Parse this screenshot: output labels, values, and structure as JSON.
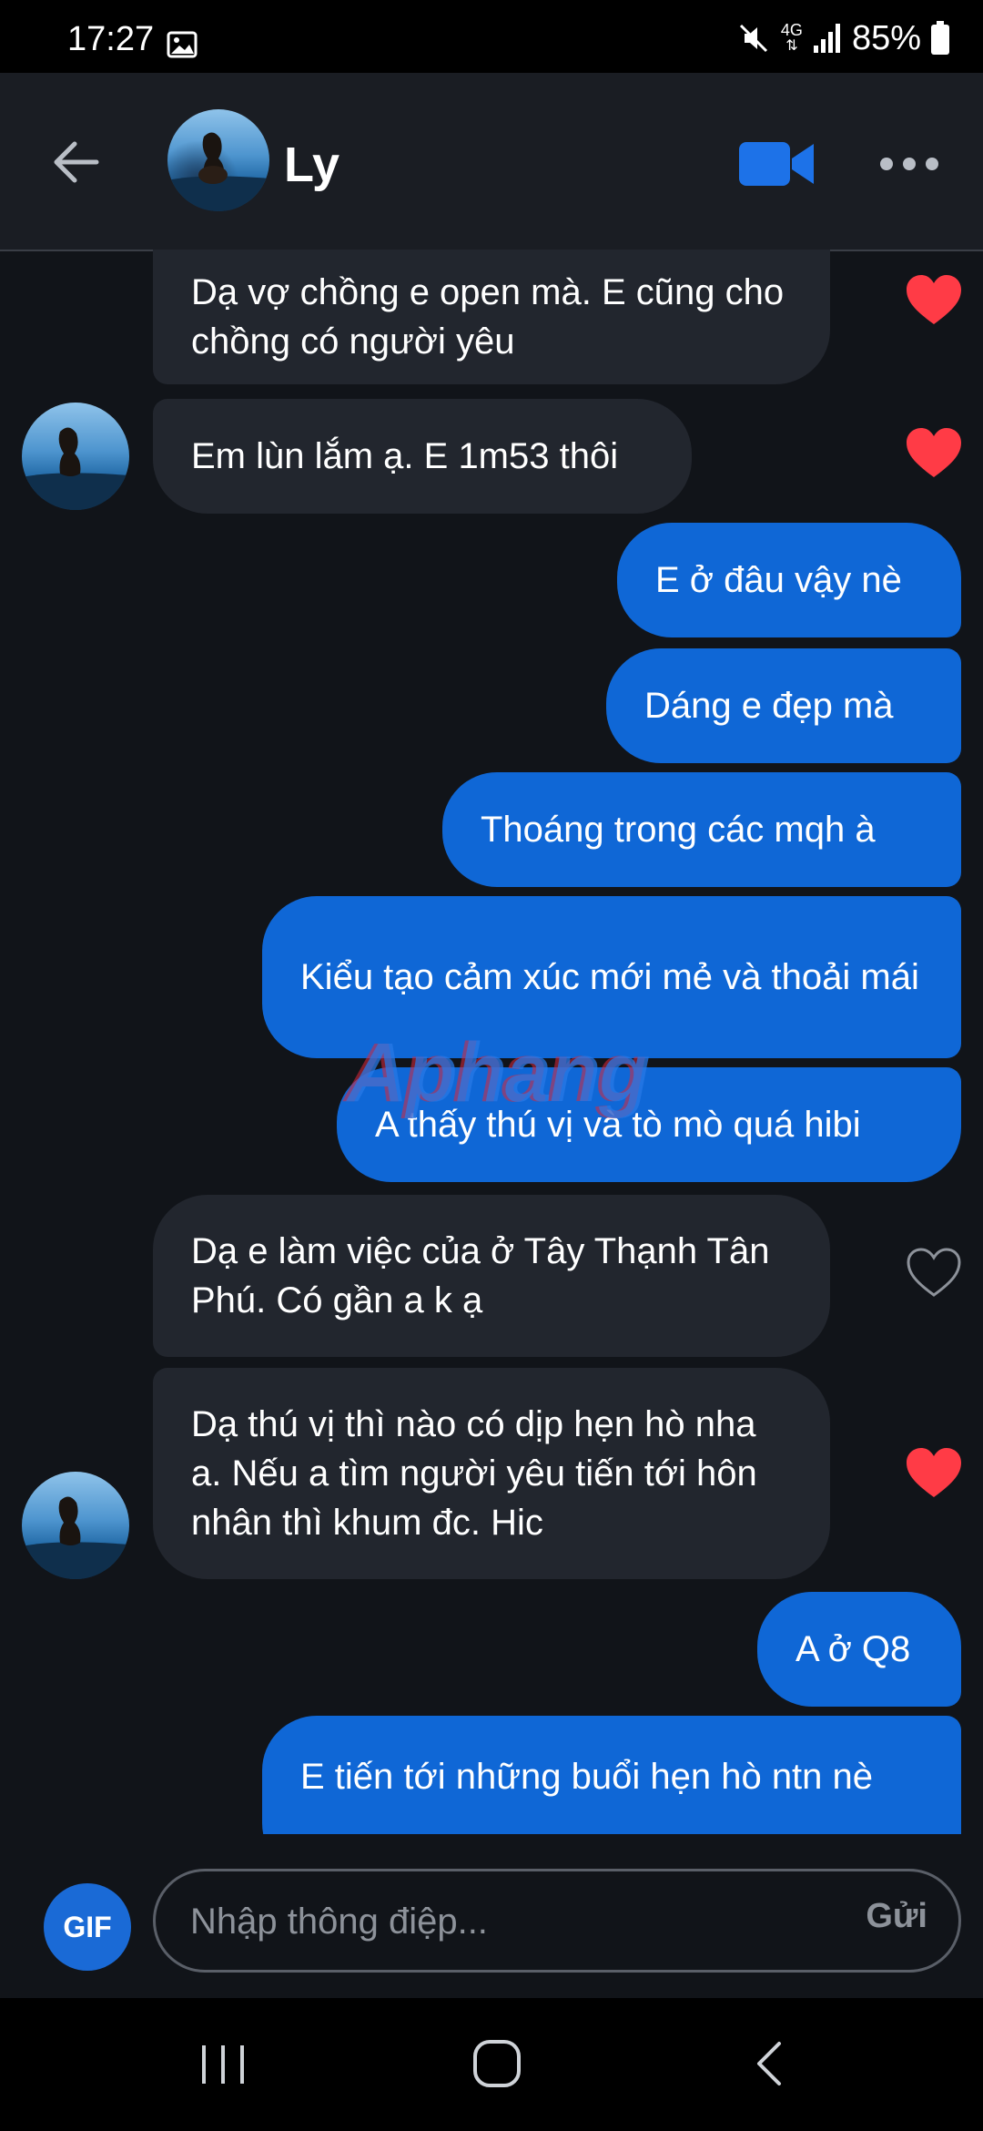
{
  "status_bar": {
    "time": "17:27",
    "network": "4G",
    "battery": "85%"
  },
  "header": {
    "contact_name": "Ly"
  },
  "messages": [
    {
      "side": "in",
      "text": "Dạ vợ chồng e open mà. E cũng cho chồng có người yêu",
      "liked": true
    },
    {
      "side": "in",
      "text": "Em lùn lắm ạ. E 1m53 thôi",
      "liked": true
    },
    {
      "side": "out",
      "text": "E ở đâu vậy nè"
    },
    {
      "side": "out",
      "text": "Dáng e đẹp mà"
    },
    {
      "side": "out",
      "text": "Thoáng trong các mqh à"
    },
    {
      "side": "out",
      "text": "Kiểu tạo cảm xúc mới mẻ và thoải mái"
    },
    {
      "side": "out",
      "text": "A thấy thú vị và tò mò quá hibi"
    },
    {
      "side": "in",
      "text": "Dạ e làm việc của ở Tây Thạnh Tân Phú. Có gần a k ạ",
      "liked": false
    },
    {
      "side": "in",
      "text": "Dạ thú vị thì nào có dịp hẹn hò nha a. Nếu a tìm người yêu tiến tới hôn nhân thì khum đc. Hic",
      "liked": true
    },
    {
      "side": "out",
      "text": "A ở Q8"
    },
    {
      "side": "out",
      "text": "E tiến tới những buổi hẹn hò ntn nè"
    }
  ],
  "watermark": "Aphang",
  "composer": {
    "gif_label": "GIF",
    "placeholder": "Nhập thông điệp...",
    "send_label": "Gửi"
  },
  "colors": {
    "outgoing_bubble": "#0f67d6",
    "incoming_bubble": "#22262e",
    "like_heart": "#ff3b46",
    "accent": "#1a6ad6"
  }
}
